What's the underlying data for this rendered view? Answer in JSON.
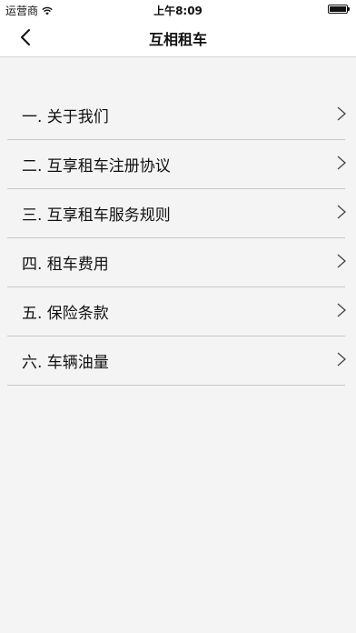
{
  "status_bar": {
    "carrier": "运营商",
    "time": "上午8:09"
  },
  "nav": {
    "title": "互相租车"
  },
  "menu": {
    "items": [
      {
        "label": "一. 关于我们"
      },
      {
        "label": "二. 互享租车注册协议"
      },
      {
        "label": "三. 互享租车服务规则"
      },
      {
        "label": "四. 租车费用"
      },
      {
        "label": "五. 保险条款"
      },
      {
        "label": "六. 车辆油量"
      }
    ]
  }
}
